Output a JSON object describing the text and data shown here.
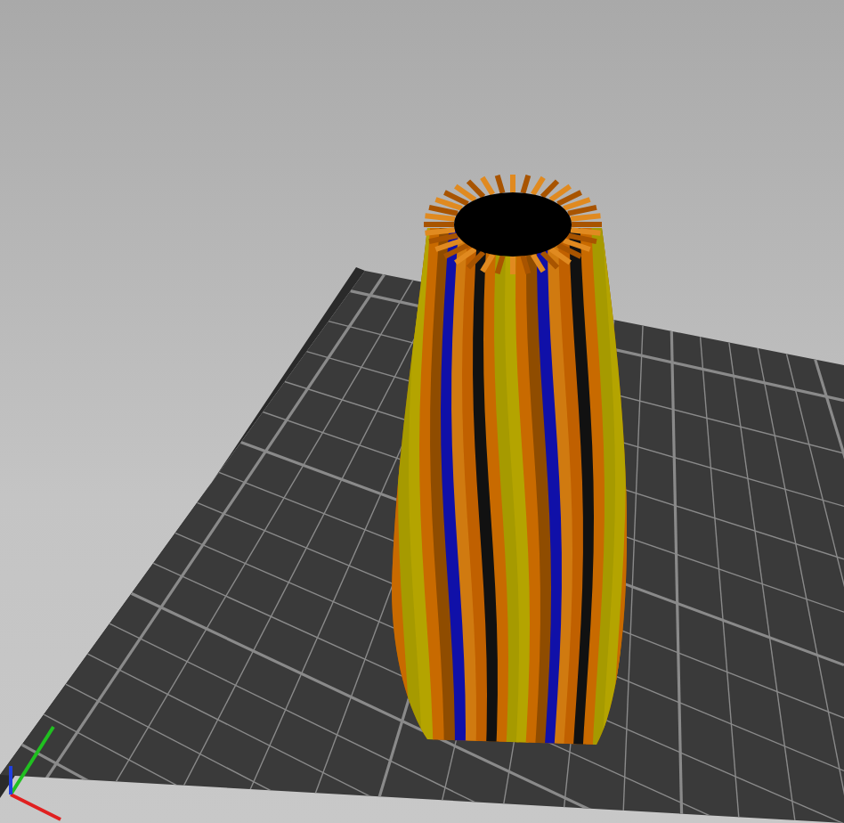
{
  "scene": {
    "kind": "build-plate-preview"
  }
}
